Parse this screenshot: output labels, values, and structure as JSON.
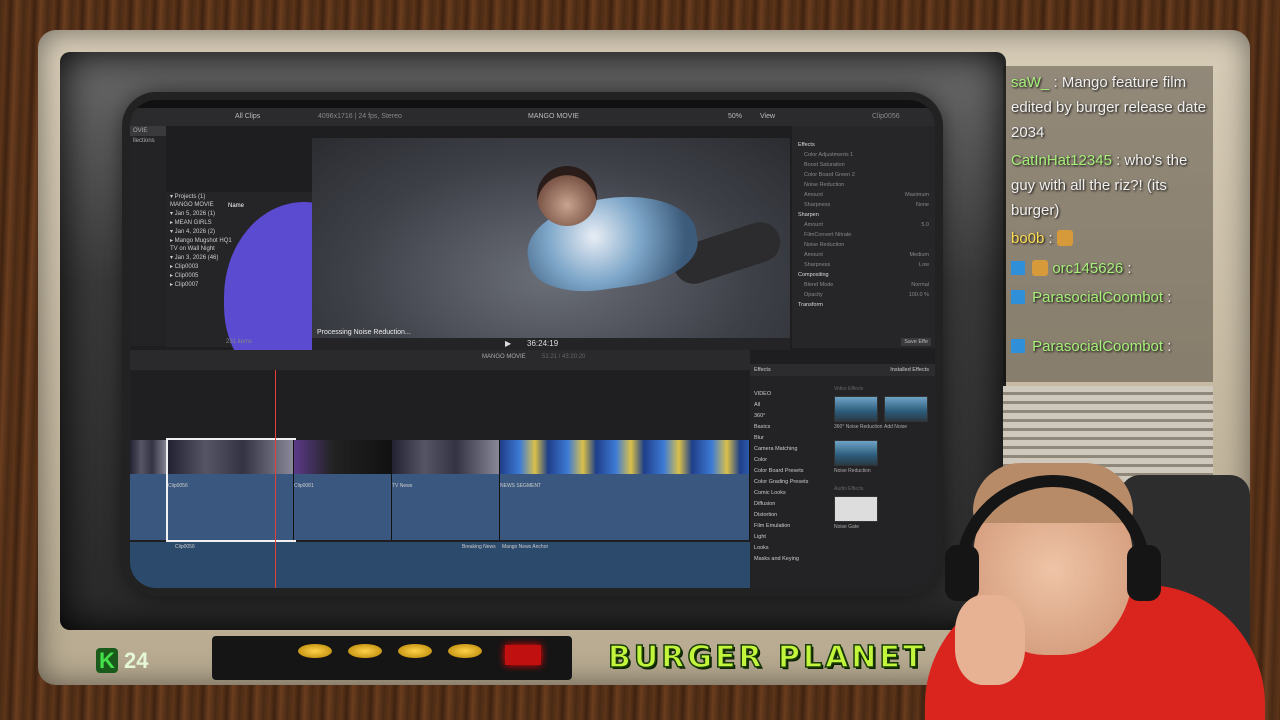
{
  "fcp": {
    "toolbar": {
      "all_clips": "All Clips",
      "format": "4096x1716 | 24 fps, Stereo",
      "project_title": "MANGO MOVIE",
      "zoom": "50%",
      "view": "View",
      "inspector_clip": "Clip0056"
    },
    "sidebar": [
      "OVIE",
      "llections"
    ],
    "browser": {
      "header": "Name",
      "rows": [
        "▾ Projects (1)",
        "      MANGO MOVIE",
        "▾ Jan 5, 2026 (1)",
        "    ▸ MEAN GIRLS",
        "▾ Jan 4, 2026 (2)",
        "    ▸ Mango Mugshot HQ1",
        "      TV on Wall Night",
        "▾ Jan 3, 2026 (46)",
        "    ▸ Clip0003",
        "    ▸ Clip0005",
        "    ▸ Clip0007"
      ],
      "count": "231 items"
    },
    "viewer": {
      "status": "Processing Noise Reduction...",
      "timecode": "36:24:19"
    },
    "inspector": {
      "rows": [
        {
          "label": "Effects",
          "val": "",
          "cls": "hdr"
        },
        {
          "label": "Color Adjustments 1",
          "val": "",
          "cls": "sub"
        },
        {
          "label": "Boost Saturation",
          "val": "",
          "cls": "sub"
        },
        {
          "label": "Color Board Green 2",
          "val": "",
          "cls": "sub"
        },
        {
          "label": "Noise Reduction",
          "val": "",
          "cls": "sub"
        },
        {
          "label": "Amount",
          "val": "Maximum",
          "cls": "sub"
        },
        {
          "label": "Sharpness",
          "val": "None",
          "cls": "sub"
        },
        {
          "label": "Sharpen",
          "val": "",
          "cls": "hdr"
        },
        {
          "label": "Amount",
          "val": "5.0",
          "cls": "sub"
        },
        {
          "label": "FilmConvert Nitrate",
          "val": "",
          "cls": "sub"
        },
        {
          "label": "Noise Reduction",
          "val": "",
          "cls": "sub"
        },
        {
          "label": "Amount",
          "val": "Medium",
          "cls": "sub"
        },
        {
          "label": "Sharpness",
          "val": "Low",
          "cls": "sub"
        },
        {
          "label": "Compositing",
          "val": "",
          "cls": "hdr"
        },
        {
          "label": "Blend Mode",
          "val": "Normal",
          "cls": "sub"
        },
        {
          "label": "Opacity",
          "val": "100.0 %",
          "cls": "sub"
        },
        {
          "label": "Transform",
          "val": "",
          "cls": "hdr"
        }
      ],
      "save_effects": "Save Effe"
    },
    "timeline": {
      "project": "MANGO MOVIE",
      "duration": "51:21 / 43:20:20",
      "clip_labels": [
        "Clip0056",
        "Clip0081",
        "TV News",
        "NEWS SEGMENT"
      ],
      "audio_labels": [
        "Clip0056",
        "Breaking News",
        "Mango News Anchor"
      ]
    },
    "effects": {
      "title": "Effects",
      "filter": "Installed Effects",
      "categories": [
        "VIDEO",
        "All",
        "360°",
        "Basics",
        "Blur",
        "Camera Matching",
        "Color",
        "Color Board Presets",
        "Color Grading Presets",
        "Comic Looks",
        "Diffusion",
        "Distortion",
        "Film Emulation",
        "Light",
        "Looks",
        "Masks and Keying"
      ],
      "video_effects_title": "Video Effects",
      "video_effects": [
        "360° Noise Reduction",
        "Add Noise",
        "Noise Reduction"
      ],
      "audio_effects_title": "Audio Effects",
      "audio_effects": [
        "Noise Gate"
      ]
    }
  },
  "chat": {
    "messages": [
      {
        "user": "saW_",
        "text": ": Mango feature film edited by burger release date 2034",
        "user_color": "#a7f07a"
      },
      {
        "user": "CatInHat12345",
        "text": ": who's the guy with all the riz?! (its burger)",
        "user_color": "#a7f07a"
      },
      {
        "user": "bo0b",
        "text": ":",
        "user_color": "#ffdd55"
      },
      {
        "user": "orc145626",
        "text": ":",
        "user_color": "#a7f07a"
      },
      {
        "user": "ParasocialCoombot",
        "text": ":",
        "user_color": "#a7f07a"
      },
      {
        "user": "ParasocialCoombot",
        "text": ":",
        "user_color": "#a7f07a"
      }
    ]
  },
  "overlay": {
    "k_label": "K",
    "k_count": "24",
    "brand": "BURGER PLANET"
  }
}
